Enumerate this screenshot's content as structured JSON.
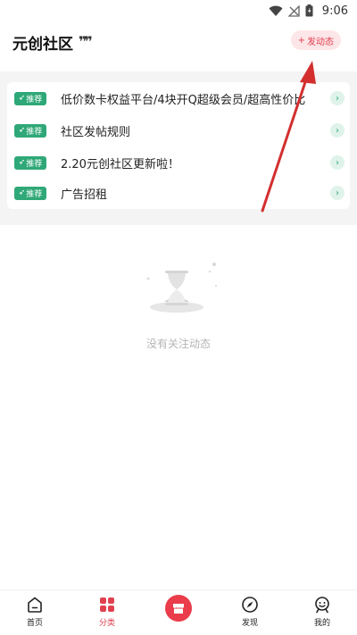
{
  "status_bar": {
    "time": "9:06"
  },
  "header": {
    "title": "元创社区",
    "post_button_label": "发动态"
  },
  "notices": [
    {
      "badge": "推荐",
      "text": "低价数卡权益平台/4块开Q超级会员/超高性价比"
    },
    {
      "badge": "推荐",
      "text": "社区发帖规则"
    },
    {
      "badge": "推荐",
      "text": "2.20元创社区更新啦！"
    },
    {
      "badge": "推荐",
      "text": "广告招租"
    }
  ],
  "empty_state": {
    "text": "没有关注动态"
  },
  "bottom_nav": {
    "items": [
      {
        "label": "首页",
        "icon": "home-icon"
      },
      {
        "label": "分类",
        "icon": "category-grid-icon",
        "active": true
      },
      {
        "label": "",
        "icon": "store-icon"
      },
      {
        "label": "发现",
        "icon": "compass-icon"
      },
      {
        "label": "我的",
        "icon": "profile-icon"
      }
    ]
  },
  "colors": {
    "accent_red": "#e0414f",
    "badge_green": "#2fa877",
    "annotation_arrow": "#d32f2f"
  }
}
